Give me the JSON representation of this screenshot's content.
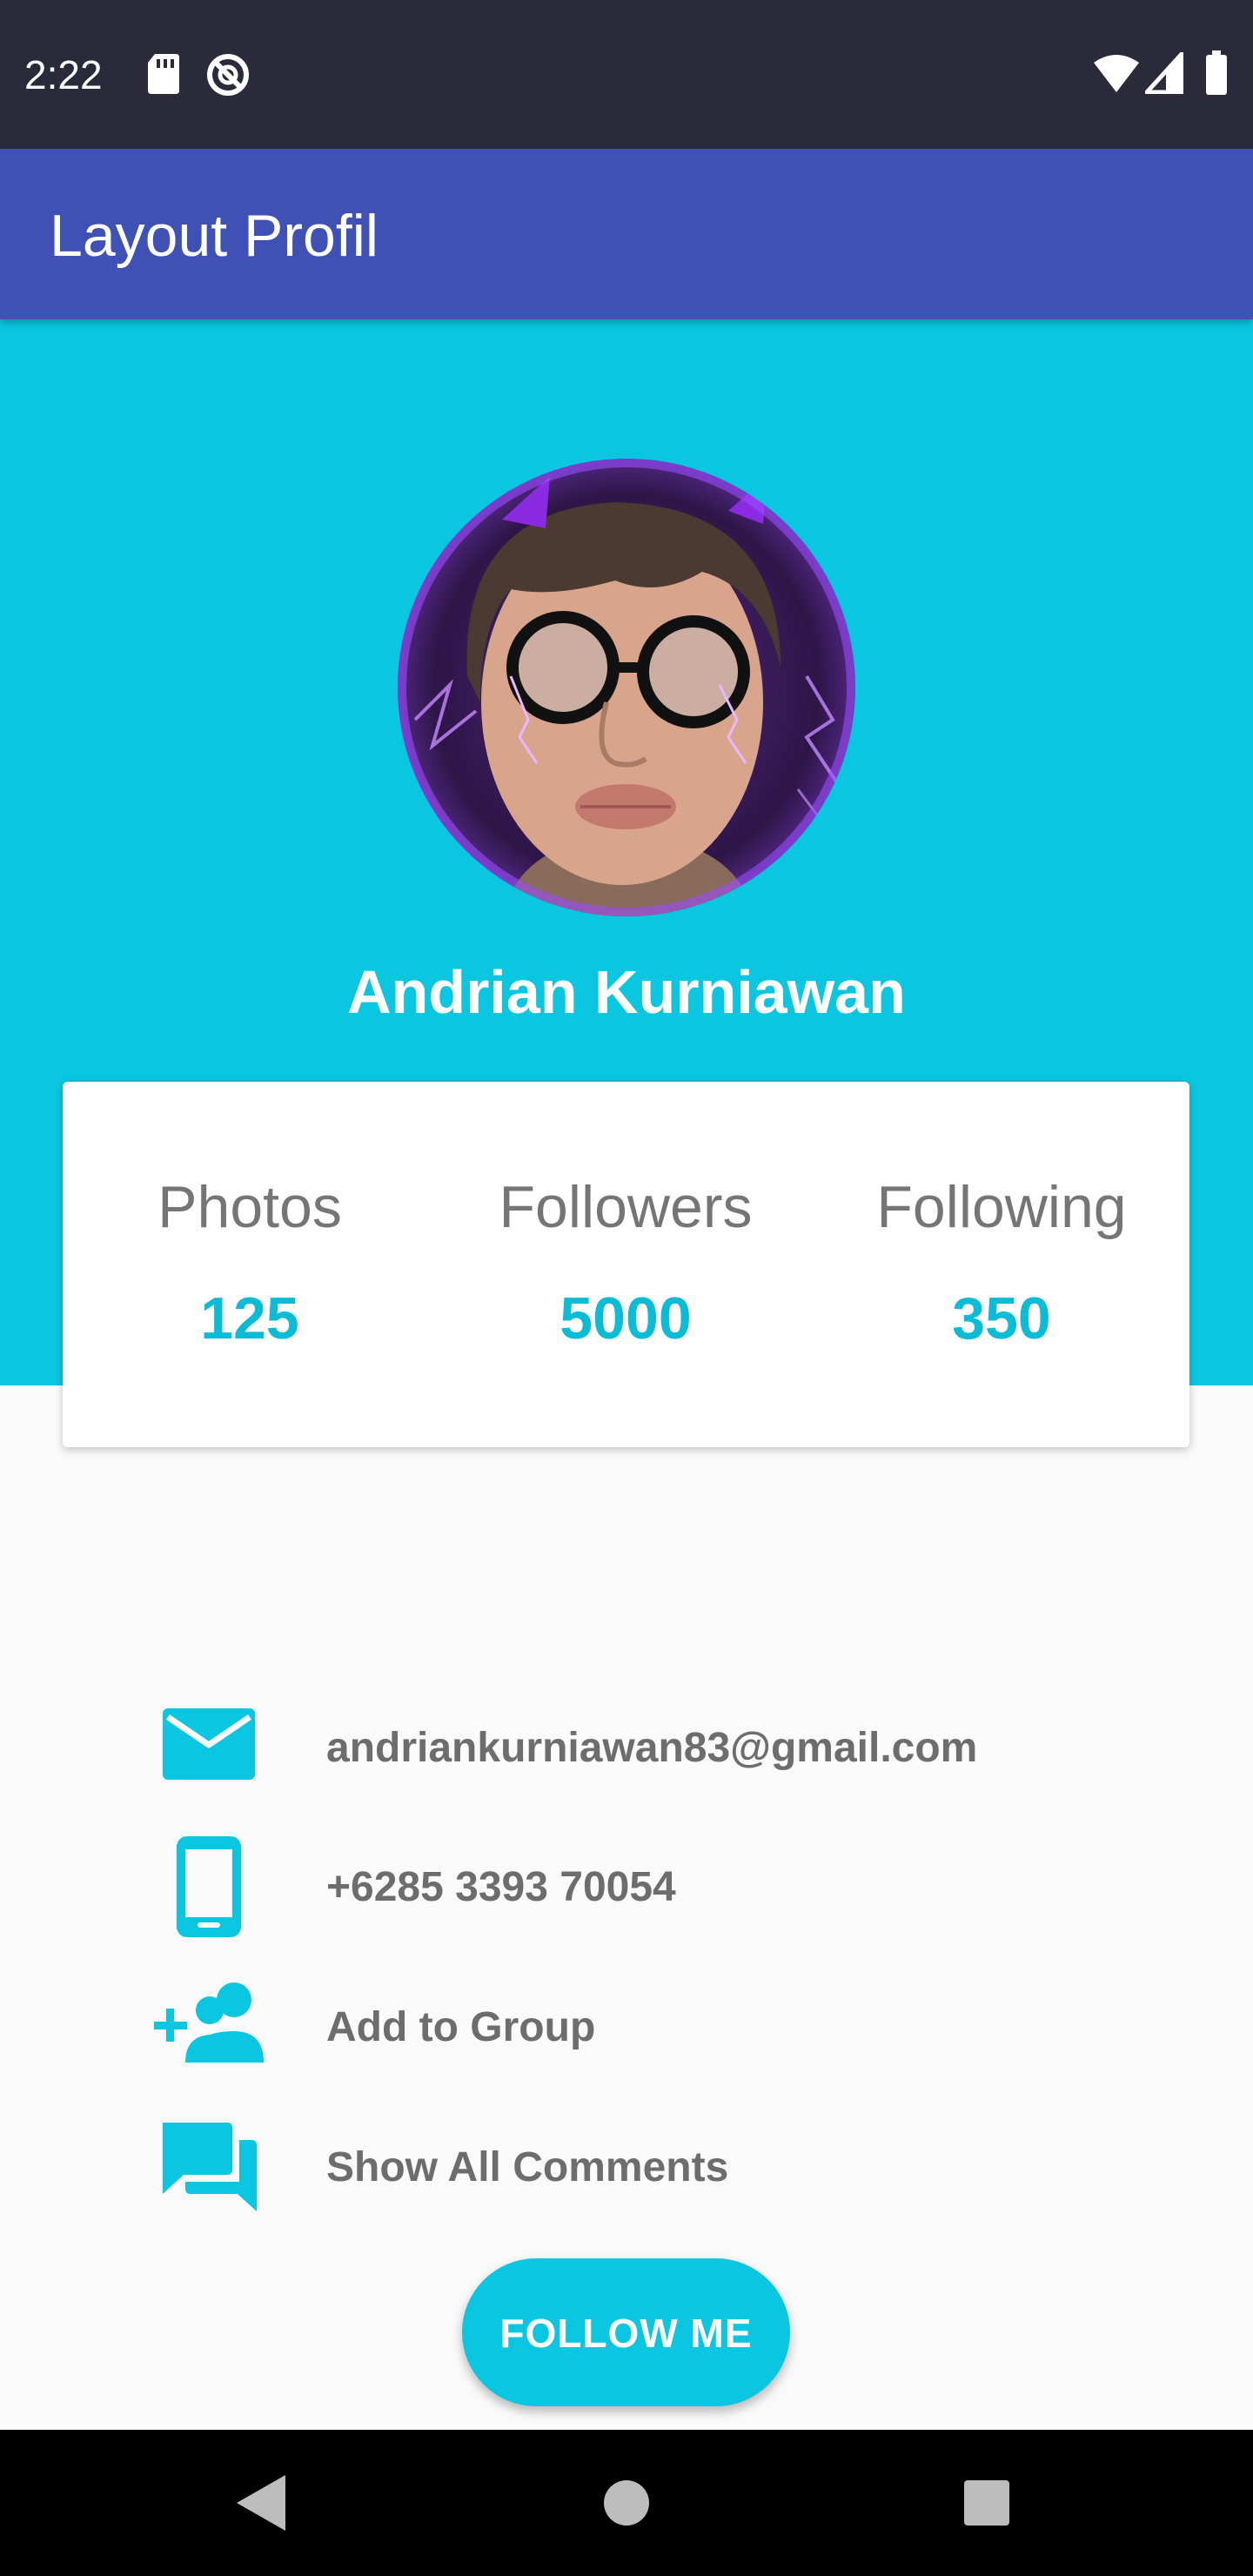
{
  "status_bar": {
    "time": "2:22"
  },
  "app_bar": {
    "title": "Layout Profil"
  },
  "profile": {
    "name": "Andrian Kurniawan"
  },
  "stats": [
    {
      "label": "Photos",
      "value": "125"
    },
    {
      "label": "Followers",
      "value": "5000"
    },
    {
      "label": "Following",
      "value": "350"
    }
  ],
  "contacts": [
    {
      "icon": "email-icon",
      "text": "andriankurniawan83@gmail.com"
    },
    {
      "icon": "phone-icon",
      "text": "+6285 3393 70054"
    },
    {
      "icon": "add-group-icon",
      "text": "Add to Group"
    },
    {
      "icon": "comments-icon",
      "text": "Show All Comments"
    }
  ],
  "actions": {
    "follow_label": "FOLLOW ME"
  },
  "colors": {
    "status_bar": "#2b2a3b",
    "app_bar": "#3f51b5",
    "accent": "#0bc6e0",
    "stat_value": "#0bbcd6",
    "text_gray": "#6d6d6d"
  }
}
